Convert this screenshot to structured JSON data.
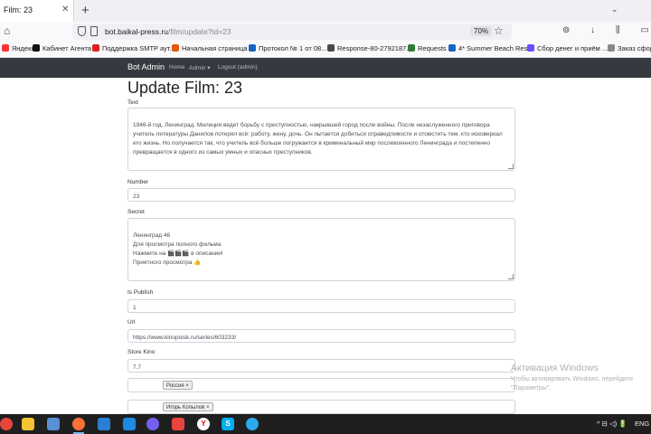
{
  "browser": {
    "tab_title": "Film: 23",
    "tab_close": "✕",
    "new_tab": "+",
    "tab_list": "⌄",
    "url_domain": "bot.baikal-press.ru",
    "url_path": "/film/update?id=23",
    "zoom": "70%",
    "toolbar_icons": "⊚ ↓ ⫼ ▭ ≡"
  },
  "bookmarks": [
    {
      "label": "Яндекс",
      "color": "#ff3333"
    },
    {
      "label": "Кабинет Агента",
      "color": "#111111"
    },
    {
      "label": "Поддержка SMTP аут...",
      "color": "#e02020"
    },
    {
      "label": "Начальная страница",
      "color": "#e05a10"
    },
    {
      "label": "Протокол № 1 от 08...",
      "color": "#1565c0"
    },
    {
      "label": "Response-80-2792187...",
      "color": "#4a4a4a"
    },
    {
      "label": "Requests",
      "color": "#2e7d32"
    },
    {
      "label": "4* Summer Beach Res...",
      "color": "#1565c0"
    },
    {
      "label": "Сбор денег и приём ...",
      "color": "#6a4cff"
    },
    {
      "label": "Заказ сформ",
      "color": "#888888"
    }
  ],
  "site": {
    "brand": "Bot Admin",
    "nav": [
      "Home",
      "Admin ▾",
      "Logout (admin)"
    ]
  },
  "form": {
    "title": "Update Film: 23",
    "text_label": "Text",
    "text_value": "1946-й год. Ленинград. Милиция ведет борьбу с преступностью, накрывшей город после войны. После незаслуженного приговора учитель литературы Данилов потерял всё: работу, жену, дочь. Он пытается добиться справедливости и отомстить тем, кто исковеркал его жизнь. Но получается так, что учитель всё больше погружается в криминальный мир послевоенного Ленинграда и постепенно превращается в одного из самых умных и опасных преступников.",
    "number_label": "Number",
    "number_value": "23",
    "secret_label": "Secret",
    "secret_value": "Ленинград 46\nДля просмотра полного фильма\nНажмите на 🎬🎬🎬 в описании!\nПриятного просмотра 👍",
    "publish_label": "Is Publish",
    "publish_value": "1",
    "url_label": "Url",
    "url_value": "https://www.kinopoisk.ru/series/603233/",
    "store_label": "Store Kino",
    "store_value": "7.7",
    "country_tag": "Россия ×",
    "actor_tag": "Игорь Копылов ×"
  },
  "watermark": {
    "title": "Активация Windows",
    "line1": "Чтобы активировать Windows, перейдите",
    "line2": "\"Параметры\"."
  },
  "taskbar": {
    "tray": "^ ⊟ ◁) 🔋",
    "lang": "ENG"
  }
}
